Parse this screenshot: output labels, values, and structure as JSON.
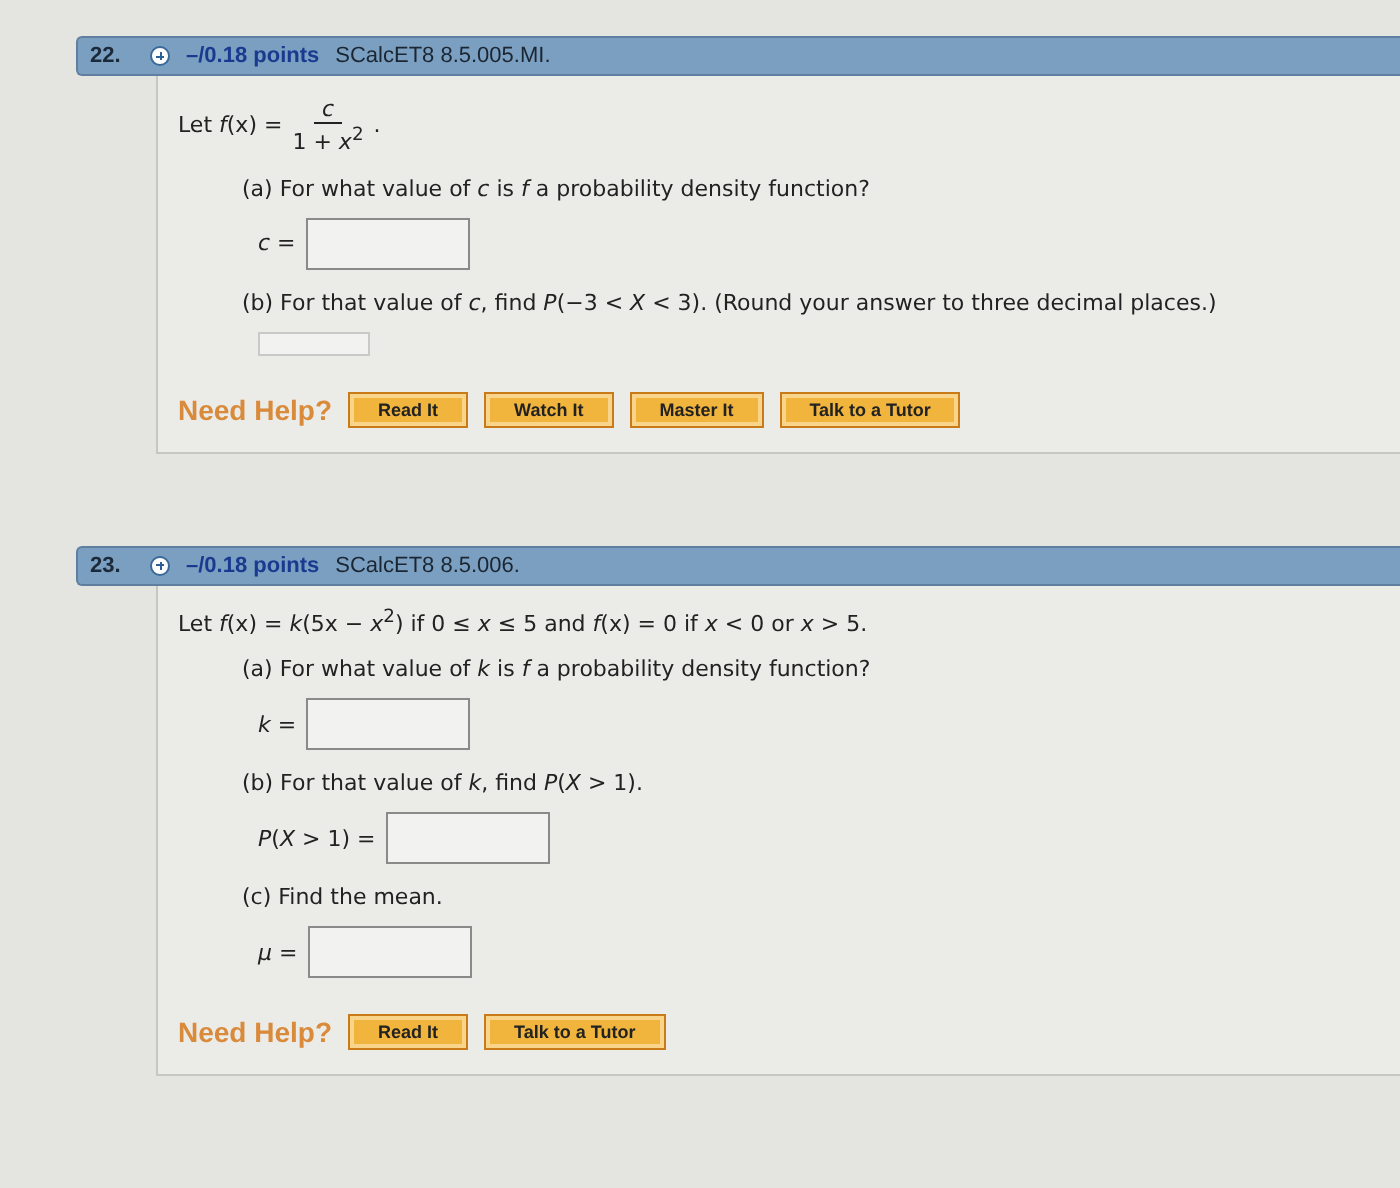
{
  "questions": [
    {
      "number": "22.",
      "points": "–/0.18 points",
      "code": "SCalcET8 8.5.005.MI.",
      "statement": {
        "kind": "fraction",
        "prefix": "Let *f*(x) =",
        "numerator": "*c*",
        "denominator": "1 + *x*$^{2}$",
        "suffix": "."
      },
      "parts": [
        {
          "prompt": "(a) For what value of *c* is *f* a probability density function?",
          "field": {
            "kind": "boxed",
            "label": "*c* ="
          }
        },
        {
          "prompt": "(b) For that value of *c*, find  *P*(−3 < *X* < 3).  (Round your answer to three decimal places.)",
          "field": {
            "kind": "small"
          }
        }
      ],
      "help": {
        "label": "Need Help?",
        "buttons": [
          "Read It",
          "Watch It",
          "Master It",
          "Talk to a Tutor"
        ]
      }
    },
    {
      "number": "23.",
      "points": "–/0.18 points",
      "code": "SCalcET8 8.5.006.",
      "statement": {
        "kind": "text",
        "text": "Let *f*(x) = *k*(5x − *x*$^{2}$)  if  0 ≤ *x* ≤ 5  and  *f*(x) = 0  if  *x* < 0  or  *x* > 5."
      },
      "parts": [
        {
          "prompt": "(a) For what value of *k* is *f* a probability density function?",
          "field": {
            "kind": "boxed",
            "label": "*k* ="
          }
        },
        {
          "prompt": "(b) For that value of *k*, find  *P*(*X* > 1).",
          "field": {
            "kind": "boxed",
            "label": "*P*(*X* > 1) ="
          }
        },
        {
          "prompt": "(c) Find the mean.",
          "field": {
            "kind": "boxed",
            "label": "*μ* ="
          }
        }
      ],
      "help": {
        "label": "Need Help?",
        "buttons": [
          "Read It",
          "Talk to a Tutor"
        ]
      }
    }
  ]
}
